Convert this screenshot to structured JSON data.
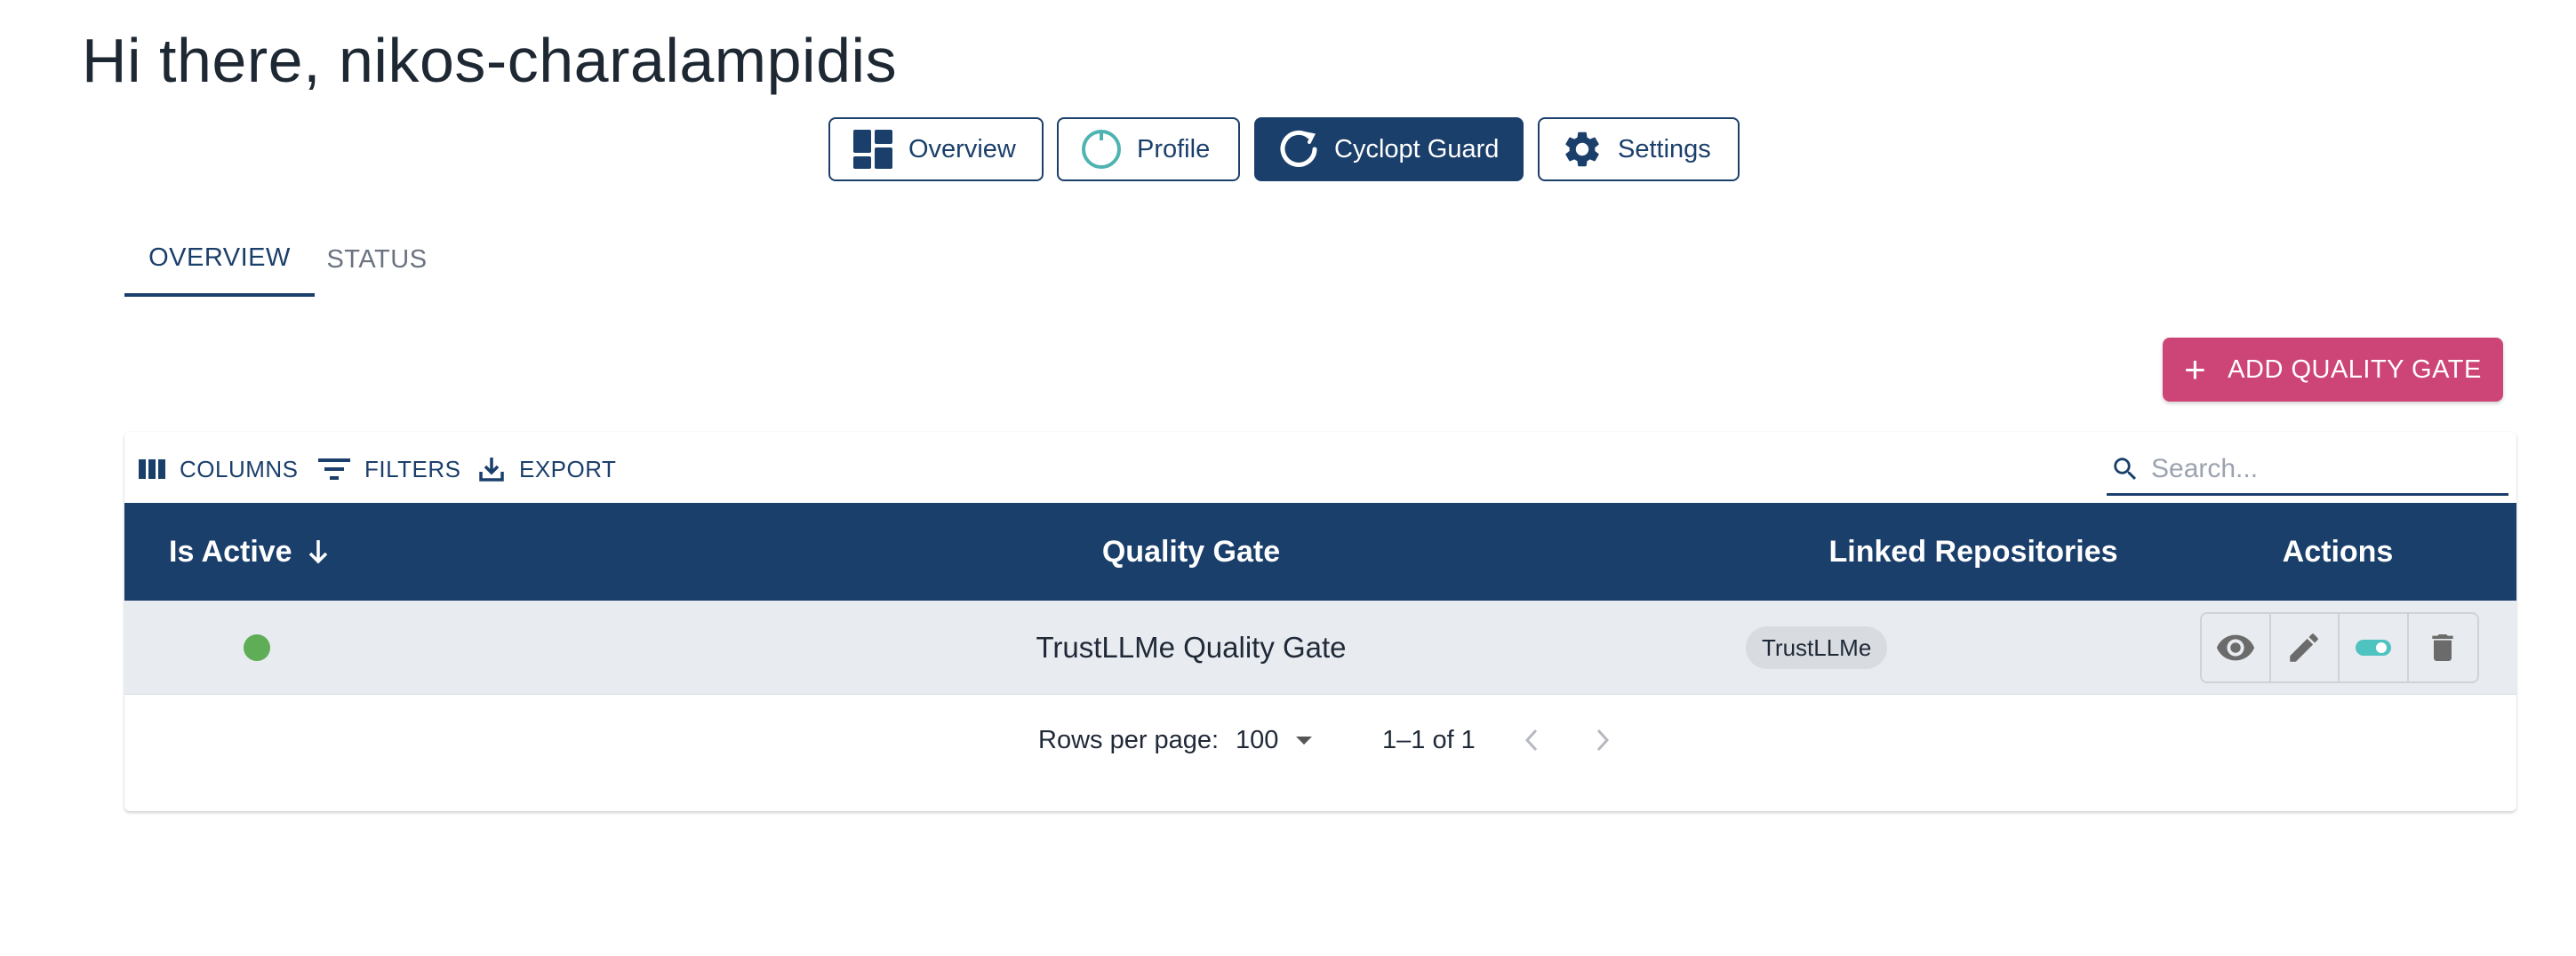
{
  "greeting": "Hi there, nikos-charalampidis",
  "nav": {
    "buttons": [
      {
        "label": "Overview",
        "icon": "dashboard-icon"
      },
      {
        "label": "Profile",
        "icon": "circle-icon"
      },
      {
        "label": "Cyclopt Guard",
        "icon": "guard-icon",
        "active": true
      },
      {
        "label": "Settings",
        "icon": "gear-icon"
      }
    ]
  },
  "tabs": [
    {
      "label": "OVERVIEW",
      "active": true
    },
    {
      "label": "STATUS",
      "active": false
    }
  ],
  "add_button": {
    "label": "ADD QUALITY GATE",
    "color": "#cd4576"
  },
  "toolbar": {
    "columns": "COLUMNS",
    "filters": "FILTERS",
    "export": "EXPORT"
  },
  "search": {
    "placeholder": "Search..."
  },
  "table": {
    "headers": {
      "is_active": "Is Active",
      "quality_gate": "Quality Gate",
      "linked_repositories": "Linked Repositories",
      "actions": "Actions"
    },
    "sort": {
      "column": "Is Active",
      "direction": "descending"
    },
    "rows": [
      {
        "is_active": true,
        "quality_gate": "TrustLLMe Quality Gate",
        "linked_repositories": [
          "TrustLLMe"
        ],
        "actions": [
          "eye-icon",
          "pencil-icon",
          "toggle-icon",
          "trash-icon"
        ]
      }
    ]
  },
  "pagination": {
    "rows_per_page_label": "Rows per page:",
    "rows_per_page": "100",
    "range": "1–1 of 1"
  },
  "colors": {
    "primary": "#1b3f6b",
    "accent": "#cd4576",
    "active_dot": "#5fad56",
    "toggle": "#4fc3c0"
  }
}
